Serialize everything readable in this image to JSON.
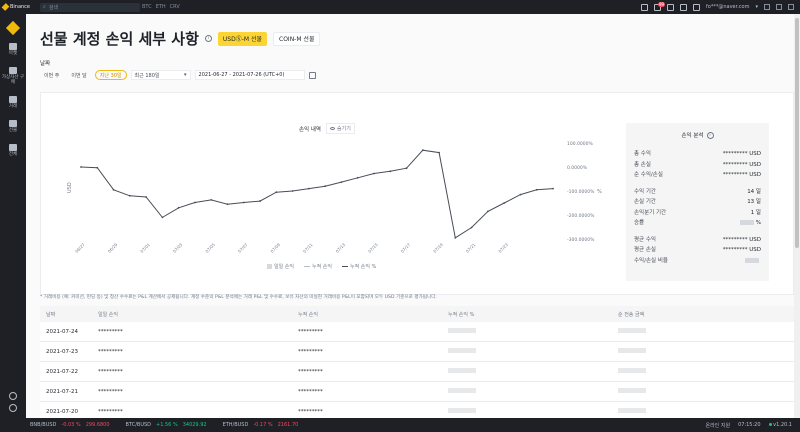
{
  "topbar": {
    "brand": "Binance",
    "search_placeholder": "검색",
    "tags": [
      "BTC",
      "ETH",
      "CRV"
    ],
    "notification_count": "99",
    "email": "fo***@naver.com"
  },
  "sidebar": {
    "items": [
      {
        "label": "마켓",
        "icon": "bar-chart-icon"
      },
      {
        "label": "가상자산 구매",
        "icon": "coin-icon"
      },
      {
        "label": "거래",
        "icon": "trade-icon"
      },
      {
        "label": "선물",
        "icon": "futures-icon"
      },
      {
        "label": "전체",
        "icon": "grid-icon"
      }
    ]
  },
  "header": {
    "title": "선물 계정 손익 세부 사항",
    "tabs": [
      {
        "label": "USDⓈ-M 선물",
        "active": true
      },
      {
        "label": "COIN-M 선물",
        "active": false
      }
    ]
  },
  "filters": {
    "date_label": "날짜",
    "chips": [
      {
        "label": "이번 주",
        "active": false
      },
      {
        "label": "이번 달",
        "active": false
      },
      {
        "label": "지난 30일",
        "active": true
      }
    ],
    "dropdown_value": "최근 180일",
    "date_range": "2021-06-27 - 2021-07-26 (UTC+0)"
  },
  "chart": {
    "title": "손익 내역",
    "hide_label": "숨기기",
    "legend": [
      "일일 손익",
      "누적 손익",
      "누적 손익 %"
    ]
  },
  "chart_data": {
    "type": "line",
    "title": "손익 내역",
    "ylabel_left": "USD",
    "ylabel_right": "%",
    "x": [
      "06/27",
      "06/28",
      "06/29",
      "06/30",
      "07/01",
      "07/02",
      "07/03",
      "07/04",
      "07/05",
      "07/06",
      "07/07",
      "07/08",
      "07/09",
      "07/10",
      "07/11",
      "07/12",
      "07/13",
      "07/14",
      "07/15",
      "07/16",
      "07/17",
      "07/18",
      "07/19",
      "07/20",
      "07/21",
      "07/22",
      "07/23",
      "07/24",
      "07/25",
      "07/26"
    ],
    "x_tick_labels": [
      "06/27",
      "06/29",
      "07/01",
      "07/03",
      "07/05",
      "07/07",
      "07/09",
      "07/11",
      "07/13",
      "07/15",
      "07/17",
      "07/19",
      "07/21",
      "07/23"
    ],
    "y_right_ticks": [
      "100.0000%",
      "0.0000%",
      "-100.0000%",
      "-200.0000%",
      "-300.0000%"
    ],
    "ylim": [
      -300,
      100
    ],
    "series": [
      {
        "name": "누적 손익 %",
        "values": [
          0,
          -3,
          -95,
          -120,
          -125,
          -210,
          -170,
          -148,
          -137,
          -155,
          -148,
          -142,
          -105,
          -100,
          -90,
          -80,
          -63,
          -45,
          -27,
          -18,
          -5,
          70,
          60,
          -295,
          -252,
          -185,
          -150,
          -115,
          -95,
          -90
        ]
      }
    ],
    "grid": false,
    "legend_position": "bottom"
  },
  "analysis": {
    "title": "손익 분석",
    "rows1": [
      {
        "label": "총 수익",
        "value": "********* USD"
      },
      {
        "label": "총 손실",
        "value": "********* USD"
      },
      {
        "label": "순 수익/손실",
        "value": "********* USD"
      }
    ],
    "rows2": [
      {
        "label": "수익 기간",
        "value": "14 일"
      },
      {
        "label": "손실 기간",
        "value": "13 일"
      },
      {
        "label": "손익분기 기간",
        "value": "1 일"
      },
      {
        "label": "승률",
        "value": "%"
      }
    ],
    "rows3": [
      {
        "label": "평균 수익",
        "value": "********* USD"
      },
      {
        "label": "평균 손실",
        "value": "********* USD"
      },
      {
        "label": "수익/손실 비율",
        "value": ""
      }
    ]
  },
  "note": "* 거래비용 (예: 커미션, 펀딩 등) 및 청산 수수료는 P&L 계산에서 공제됩니다. 계정 수준의 P&L 분석에는 거래 P&L 및 수수료, 보유 자산의 미실현 거래비용 P&L이 포함되며 모두 USD 기준으로 평가됩니다.",
  "table": {
    "headers": [
      "날짜",
      "일일 손익",
      "누적 손익",
      "누적 손익 %",
      "순 전송 금액"
    ],
    "rows": [
      {
        "date": "2021-07-24",
        "daily": "*********",
        "cum": "*********"
      },
      {
        "date": "2021-07-23",
        "daily": "*********",
        "cum": "*********"
      },
      {
        "date": "2021-07-22",
        "daily": "*********",
        "cum": "*********"
      },
      {
        "date": "2021-07-21",
        "daily": "*********",
        "cum": "*********"
      },
      {
        "date": "2021-07-20",
        "daily": "*********",
        "cum": "*********"
      }
    ]
  },
  "ticker": {
    "items": [
      {
        "pair": "BNB/BUSD",
        "change": "-0.03 %",
        "price": "299.6800",
        "direction": "neg"
      },
      {
        "pair": "BTC/BUSD",
        "change": "+1.56 %",
        "price": "34029.92",
        "direction": "pos"
      },
      {
        "pair": "ETH/BUSD",
        "change": "-0.17 %",
        "price": "2161.70",
        "direction": "neg"
      }
    ],
    "right": [
      "온라인 지원",
      "07:15:20",
      "v1.20.1"
    ]
  }
}
